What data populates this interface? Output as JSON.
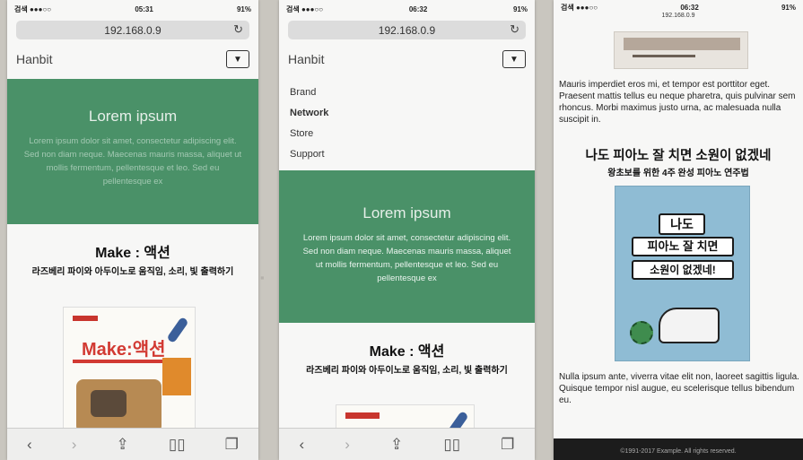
{
  "phones": [
    {
      "status": {
        "carrier": "검색 ●●●○○",
        "time": "05:31",
        "battery": "91%"
      },
      "url": "192.168.0.9",
      "brand": "Hanbit",
      "hero": {
        "title": "Lorem ipsum",
        "body": "Lorem ipsum dolor sit amet, consectetur adipiscing elit. Sed non diam neque. Maecenas mauris massa, aliquet ut mollis fermentum, pellentesque et leo. Sed eu pellentesque ex"
      },
      "section": {
        "title": "Make : 액션",
        "subtitle": "라즈베리 파이와 아두이노로 움직임, 소리, 빛 출력하기"
      },
      "book_cover": {
        "title": "Make:액션"
      }
    },
    {
      "status": {
        "carrier": "검색 ●●●○○",
        "time": "06:32",
        "battery": "91%"
      },
      "url": "192.168.0.9",
      "brand": "Hanbit",
      "menu": [
        "Brand",
        "Network",
        "Store",
        "Support"
      ],
      "hero": {
        "title": "Lorem ipsum",
        "body": "Lorem ipsum dolor sit amet, consectetur adipiscing elit. Sed non diam neque. Maecenas mauris massa, aliquet ut mollis fermentum, pellentesque et leo. Sed eu pellentesque ex"
      },
      "section": {
        "title": "Make : 액션",
        "subtitle": "라즈베리 파이와 아두이노로 움직임, 소리, 빛 출력하기"
      }
    },
    {
      "status": {
        "carrier": "검색 ●●●○○",
        "time": "06:32",
        "battery": "91%"
      },
      "url": "192.168.0.9",
      "para1": "Mauris imperdiet eros mi, et tempor est porttitor eget. Praesent mattis tellus eu neque pharetra, quis pulvinar sem rhoncus. Morbi maximus justo urna, ac malesuada nulla suscipit in.",
      "heading": "나도 피아노 잘 치면 소원이 없겠네",
      "subheading": "왕초보를 위한 4주 완성 피아노 연주법",
      "poster_lines": [
        "나도",
        "피아노 잘 치면",
        "소원이 없겠네!"
      ],
      "para2": "Nulla ipsum ante, viverra vitae elit non, laoreet sagittis ligula. Quisque tempor nisl augue, eu scelerisque tellus bibendum eu.",
      "footer": "©1991-2017 Example. All rights reserved."
    }
  ],
  "toolbar_icons": [
    "back-arrow-icon",
    "forward-arrow-icon",
    "share-icon",
    "bookmarks-icon",
    "tabs-icon"
  ],
  "colors": {
    "hero_green": "#4a9168",
    "footer_dark": "#1c1c1c"
  }
}
